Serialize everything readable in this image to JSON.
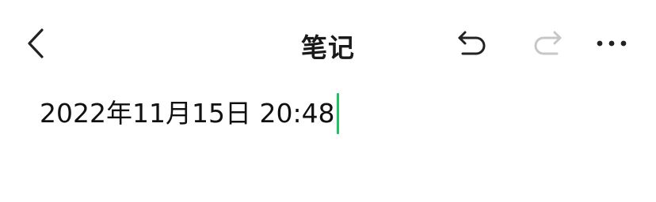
{
  "header": {
    "title": "笔记",
    "icons": {
      "back": "chevron-left-icon",
      "undo": "undo-icon",
      "redo": "redo-icon",
      "more": "more-horizontal-icon"
    },
    "redo_enabled": false
  },
  "editor": {
    "content": "2022年11月15日 20:48"
  },
  "colors": {
    "icon_active": "#222222",
    "icon_disabled": "#c7c7c7",
    "caret": "#21c065",
    "text": "#111111",
    "background": "#ffffff"
  }
}
